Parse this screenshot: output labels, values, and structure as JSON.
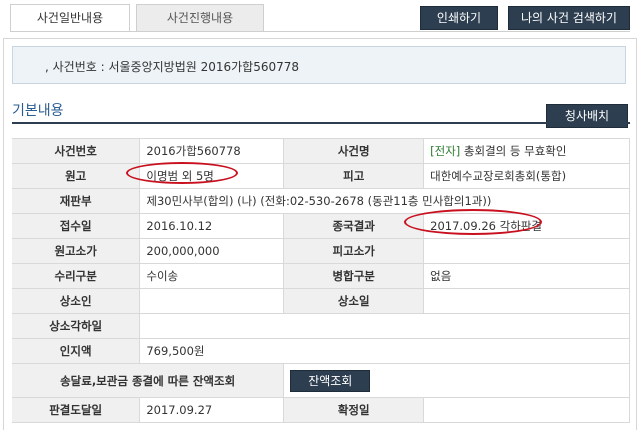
{
  "tabs": {
    "general": "사건일반내용",
    "progress": "사건진행내용"
  },
  "toolbar": {
    "print": "인쇄하기",
    "my_case_search": "나의 사건 검색하기"
  },
  "case_header": {
    "text": "사건번호 : 서울중앙지방법원 2016가합560778"
  },
  "section": {
    "title": "기본내용",
    "assign_button": "청사배치"
  },
  "table": {
    "case_no_label": "사건번호",
    "case_no": "2016가합560778",
    "case_name_label": "사건명",
    "case_name_tag": "[전자]",
    "case_name": " 총회결의 등 무효확인",
    "plaintiff_label": "원고",
    "plaintiff": "이명범 외 5명",
    "defendant_label": "피고",
    "defendant": "대한예수교장로회총회(통합)",
    "division_label": "재판부",
    "division": "제30민사부(합의) (나) (전화:02-530-2678 (동관11층 민사합의1과))",
    "receipt_date_label": "접수일",
    "receipt_date": "2016.10.12",
    "final_result_label": "종국결과",
    "final_result": "2017.09.26 각하판결",
    "plaintiff_value_label": "원고소가",
    "plaintiff_value": "200,000,000",
    "defendant_value_label": "피고소가",
    "defendant_value": "",
    "accept_type_label": "수리구분",
    "accept_type": "수이송",
    "merge_type_label": "병합구분",
    "merge_type": "없음",
    "appeal_label": "상소인",
    "appeal": "",
    "appeal_date_label": "상소일",
    "appeal_date": "",
    "appeal_reject_date_label": "상소각하일",
    "appeal_reject_date": "",
    "stamp_fee_label": "인지액",
    "stamp_fee": "769,500원",
    "deposit_label": "송달료,보관금 종결에 따른 잔액조회",
    "balance_button": "잔액조회",
    "judgment_delivery_label": "판결도달일",
    "judgment_delivery": "2017.09.27",
    "confirm_date_label": "확정일",
    "confirm_date": ""
  },
  "colors": {
    "header_dark": "#2d3e50",
    "annotation_red": "#c8101e",
    "tag_green": "#2f7d32"
  }
}
